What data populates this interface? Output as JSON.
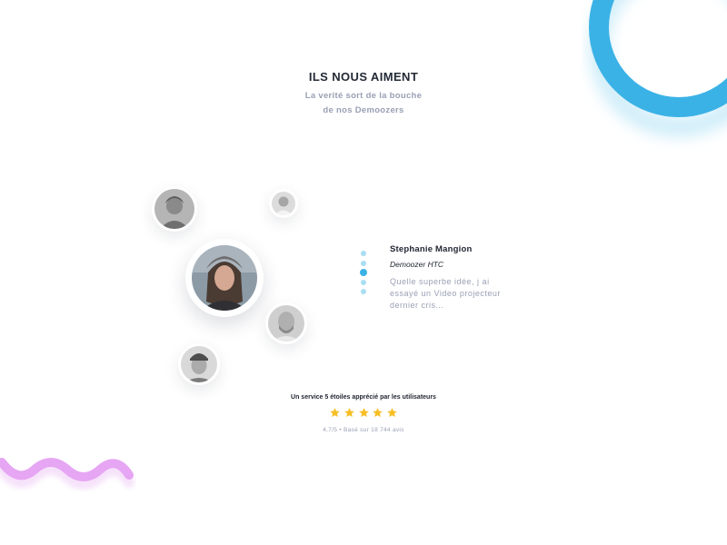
{
  "section": {
    "title": "ILS NOUS AIMENT",
    "subtitle_line1": "La verité sort de la bouche",
    "subtitle_line2": "de nos Demoozers"
  },
  "testimonial": {
    "name": "Stephanie Mangion",
    "role": "Demoozer HTC",
    "quote_line1": "Quelle superbe idée, j ai",
    "quote_line2": "essayé un Video projecteur",
    "quote_line3": "dernier cris..."
  },
  "pager": {
    "count": 5,
    "active_index": 2
  },
  "rating": {
    "caption": "Un service 5 étoiles apprécié par les utilisateurs",
    "stars": 5,
    "summary": "4,7/5 • Basé sur 18 744 avis"
  },
  "colors": {
    "accent_blue": "#3bb2e6",
    "deco_purple": "#e6a6f3",
    "star_yellow": "#f6bf26",
    "title_text": "#232a36",
    "muted_text": "#9aa0b4"
  },
  "icons": {
    "star": "star-icon",
    "avatar": "avatar-photo"
  }
}
